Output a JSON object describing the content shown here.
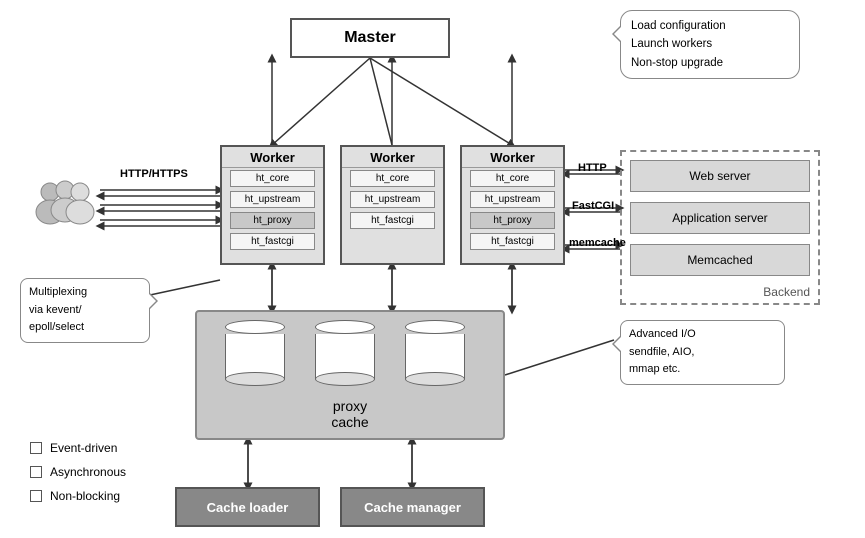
{
  "master": {
    "label": "Master"
  },
  "callout_master": {
    "lines": [
      "Load configuration",
      "Launch workers",
      "Non-stop upgrade"
    ]
  },
  "workers": [
    {
      "title": "Worker",
      "modules": [
        "ht_core",
        "ht_upstream",
        "ht_proxy",
        "ht_fastcgi"
      ]
    },
    {
      "title": "Worker",
      "modules": [
        "ht_core",
        "ht_upstream",
        "ht_fastcgi"
      ]
    },
    {
      "title": "Worker",
      "modules": [
        "ht_core",
        "ht_upstream",
        "ht_proxy",
        "ht_fastcgi"
      ]
    }
  ],
  "backend": {
    "label": "Backend",
    "servers": [
      "Web server",
      "Application server",
      "Memcached"
    ]
  },
  "labels": {
    "http_https": "HTTP/HTTPS",
    "http": "HTTP",
    "fastcgi": "FastCGI",
    "memcache": "memcache"
  },
  "proxy_cache": {
    "label": "proxy\ncache"
  },
  "callout_left": {
    "lines": [
      "Multiplexing",
      "via kevent/",
      "epoll/select"
    ]
  },
  "callout_right": {
    "lines": [
      "Advanced I/O",
      "sendfile, AIO,",
      "mmap etc."
    ]
  },
  "cache": {
    "loader": "Cache loader",
    "manager": "Cache manager"
  },
  "legend": {
    "items": [
      "Event-driven",
      "Asynchronous",
      "Non-blocking"
    ]
  }
}
